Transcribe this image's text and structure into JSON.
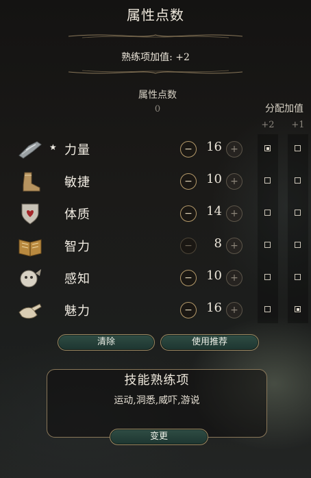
{
  "header": {
    "title": "属性点数"
  },
  "proficiency": {
    "text": "熟练项加值: +2"
  },
  "points": {
    "label": "属性点数",
    "value": "0"
  },
  "allocation": {
    "label": "分配加值",
    "col_plus2": "+2",
    "col_plus1": "+1"
  },
  "abilities": [
    {
      "name": "力量",
      "value": "16",
      "starred": true,
      "icon": "gauntlet-icon",
      "plus2": true,
      "plus1": false,
      "minus_enabled": true
    },
    {
      "name": "敏捷",
      "value": "10",
      "starred": false,
      "icon": "boot-icon",
      "plus2": false,
      "plus1": false,
      "minus_enabled": true
    },
    {
      "name": "体质",
      "value": "14",
      "starred": false,
      "icon": "heart-shield-icon",
      "plus2": false,
      "plus1": false,
      "minus_enabled": true
    },
    {
      "name": "智力",
      "value": "8",
      "starred": false,
      "icon": "book-icon",
      "plus2": false,
      "plus1": false,
      "minus_enabled": false
    },
    {
      "name": "感知",
      "value": "10",
      "starred": false,
      "icon": "owlbear-icon",
      "plus2": false,
      "plus1": false,
      "minus_enabled": true
    },
    {
      "name": "魅力",
      "value": "16",
      "starred": false,
      "icon": "hand-icon",
      "plus2": false,
      "plus1": true,
      "minus_enabled": true
    }
  ],
  "buttons": {
    "clear": "清除",
    "recommend": "使用推荐",
    "change": "变更"
  },
  "skills": {
    "title": "技能熟练项",
    "list": "运动,洞悉,威吓,游说"
  },
  "symbols": {
    "star": "★",
    "minus": "−",
    "plus": "+"
  },
  "colors": {
    "accent": "#b59a6a",
    "button": "#2f4d44"
  }
}
